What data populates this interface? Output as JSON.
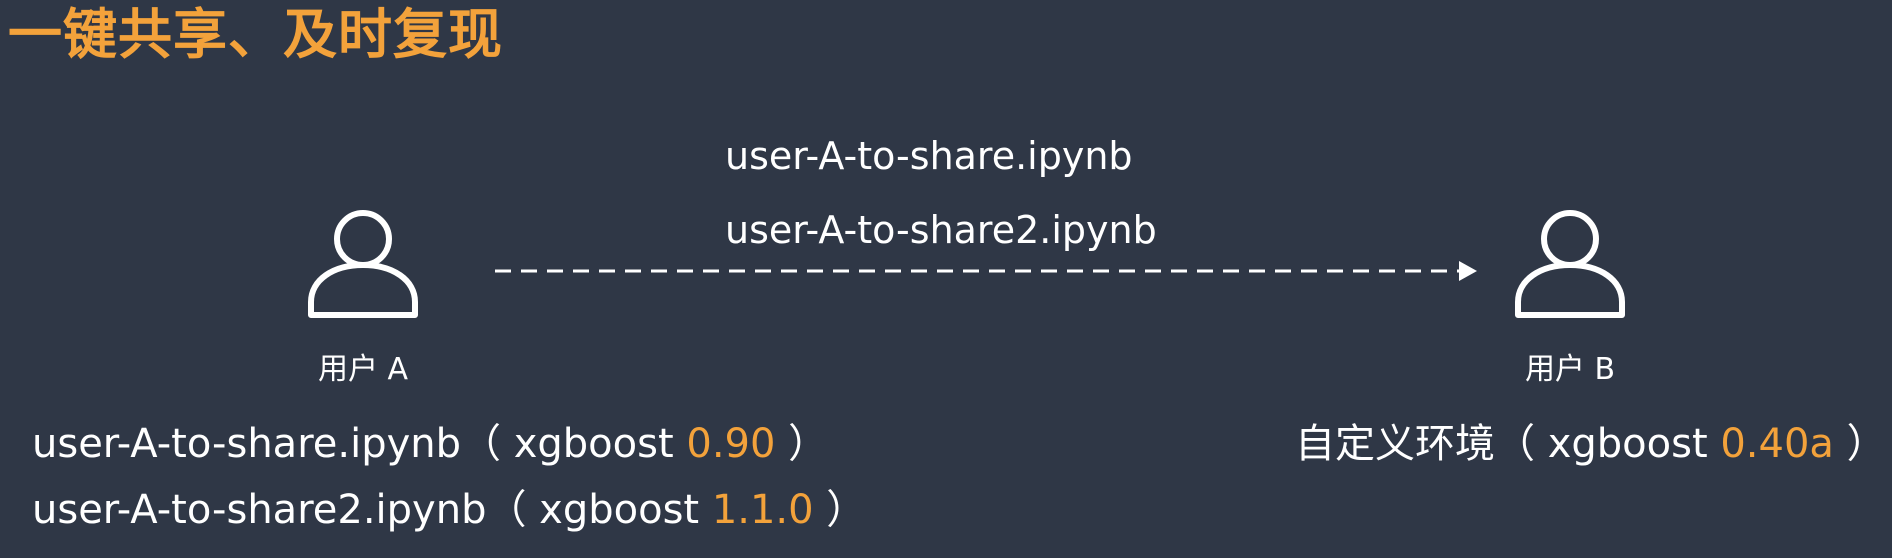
{
  "title": "一键共享、及时复现",
  "shared_files": [
    "user-A-to-share.ipynb",
    "user-A-to-share2.ipynb"
  ],
  "user_a": {
    "label": "用户 A",
    "files": [
      {
        "name": "user-A-to-share.ipynb",
        "open": "（ xgboost ",
        "version": "0.90",
        "close": " ）"
      },
      {
        "name": "user-A-to-share2.ipynb",
        "open": "（ xgboost ",
        "version": "1.1.0",
        "close": " ）"
      }
    ]
  },
  "user_b": {
    "label": "用户 B",
    "env": {
      "name": "自定义环境",
      "open": "（ xgboost ",
      "version": "0.40a",
      "close": " ）"
    }
  },
  "colors": {
    "background": "#2f3746",
    "accent": "#f3a23b",
    "text": "#ffffff"
  },
  "icons": {
    "user": "user-icon",
    "arrow": "dashed-arrow-right"
  }
}
